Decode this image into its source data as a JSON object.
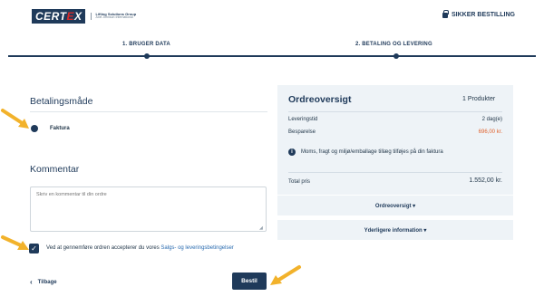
{
  "header": {
    "logo_text_a": "CERT",
    "logo_text_x": "E",
    "logo_text_b": "X",
    "logo_sub1": "Lifting Solutions Group",
    "logo_sub2": "Axel Johnson International",
    "secure_label": "SIKKER BESTILLING"
  },
  "steps": [
    {
      "label": "1. BRUGER DATA"
    },
    {
      "label": "2. BETALING OG LEVERING"
    }
  ],
  "payment": {
    "heading": "Betalingsmåde",
    "option_label": "Faktura"
  },
  "comment": {
    "heading": "Kommentar",
    "placeholder": "Skriv en kommentar til din ordre"
  },
  "terms": {
    "text": "Ved at gennemføre ordren accepterer du vores ",
    "link": "Salgs- og leveringsbetingelser"
  },
  "footer": {
    "back_label": "Tilbage",
    "order_label": "Bestil"
  },
  "summary": {
    "title": "Ordreoversigt",
    "count": "1 Produkter",
    "delivery_label": "Leveringstid",
    "delivery_value": "2 dag(e)",
    "savings_label": "Besparelse",
    "savings_value": "696,00 kr.",
    "info_text": "Moms, fragt og miljø/emballage tillæg tilføjes på din faktura",
    "total_label": "Total pris",
    "total_value": "1.552,00 kr.",
    "accordion1": "Ordreoversigt ▾",
    "accordion2": "Yderligere information ▾"
  },
  "colors": {
    "primary": "#1f3a5a",
    "panel_bg": "#eef3f7",
    "savings": "#e0622e",
    "annotation_arrow": "#f2b22b"
  }
}
